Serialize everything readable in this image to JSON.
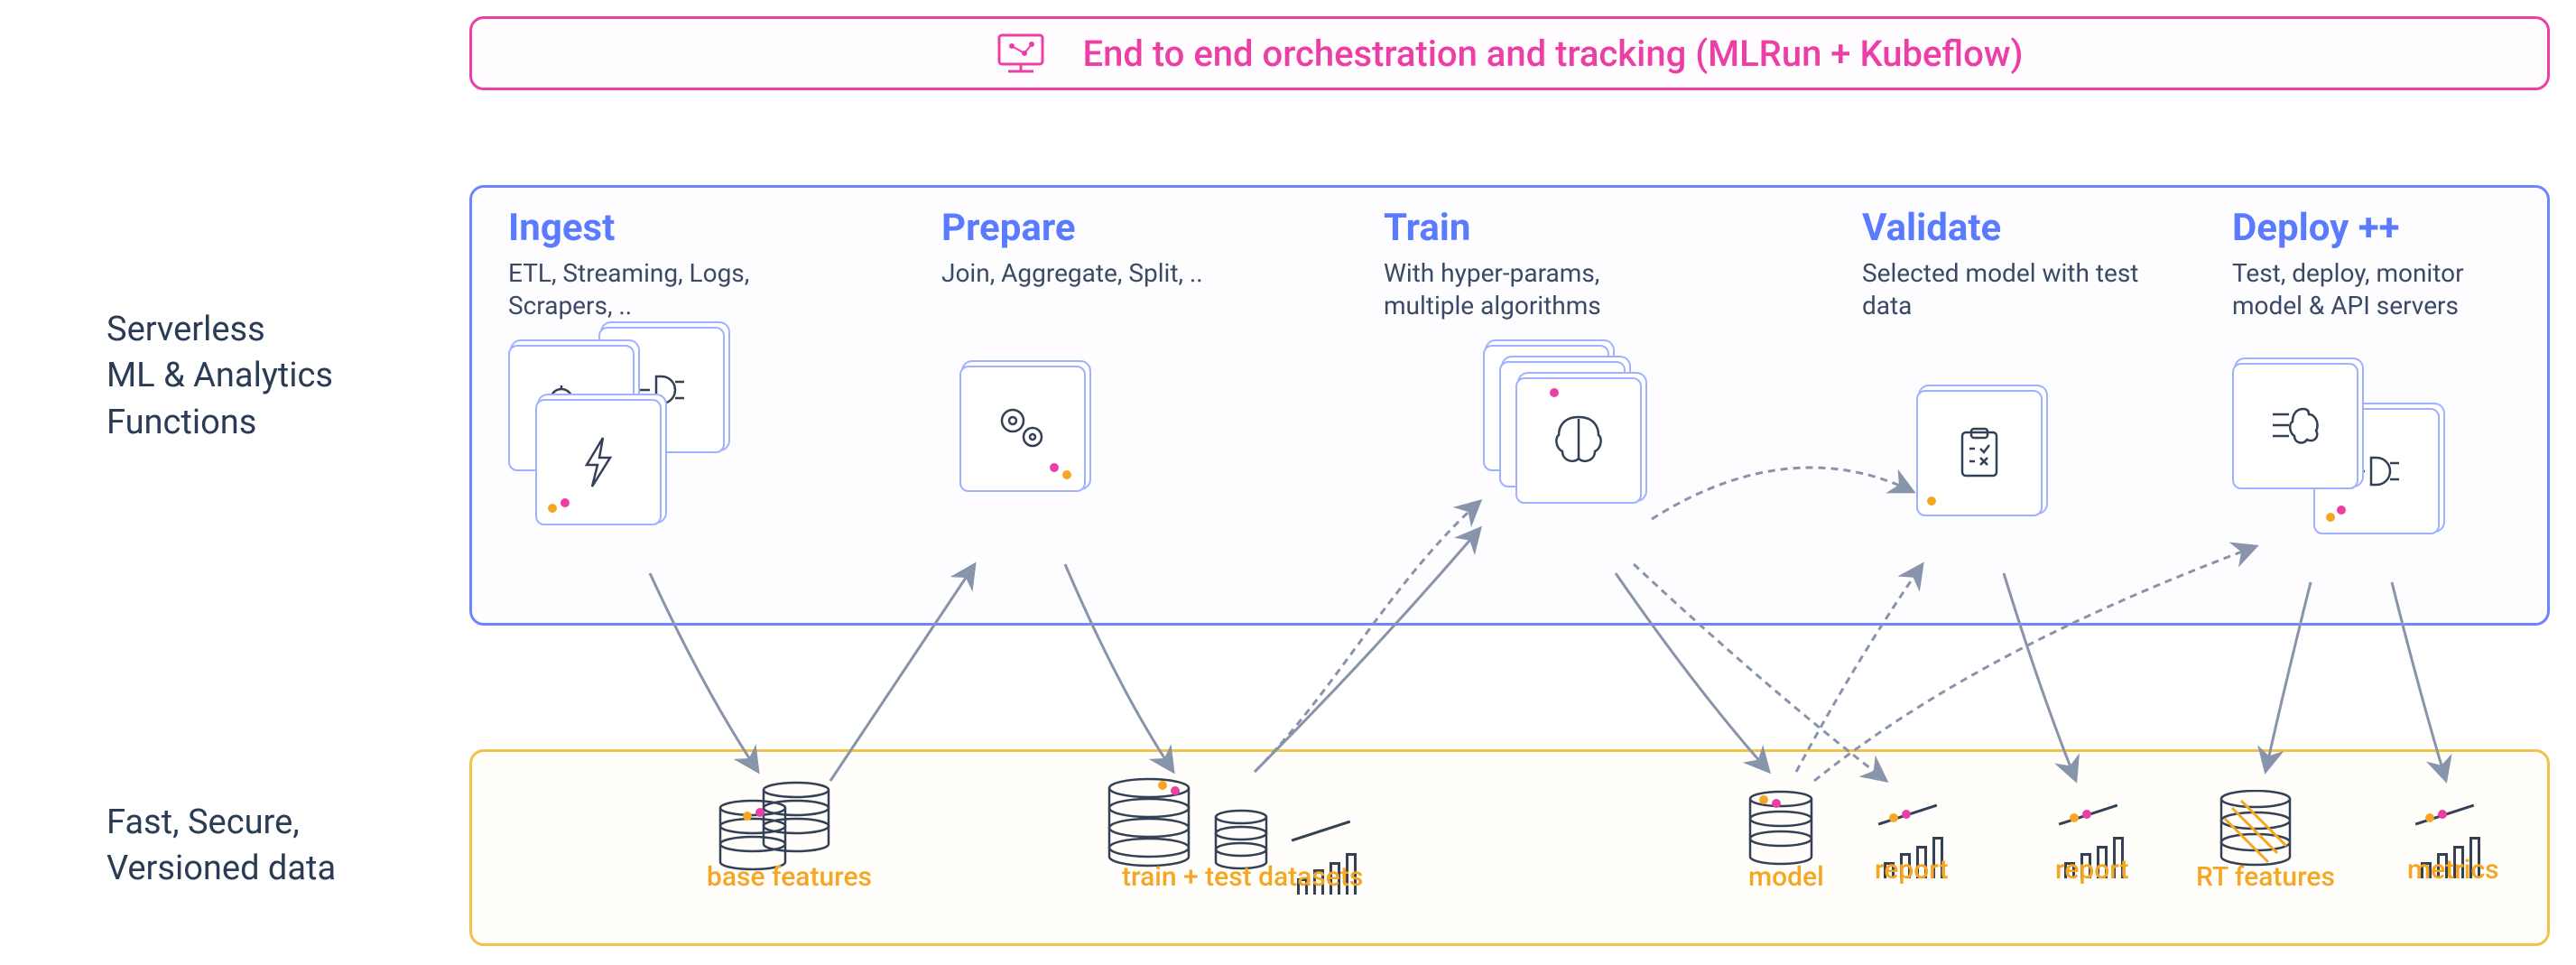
{
  "orchestration": {
    "title": "End to end orchestration and tracking (MLRun + Kubeflow)",
    "icon": "monitor-pipeline-icon"
  },
  "side_labels": {
    "functions": "Serverless\nML & Analytics\nFunctions",
    "data": "Fast, Secure,\nVersioned data"
  },
  "stages": [
    {
      "key": "ingest",
      "title": "Ingest",
      "desc": "ETL, Streaming, Logs, Scrapers, ..",
      "icons": [
        "gears-icon",
        "plug-icon",
        "lightning-icon"
      ]
    },
    {
      "key": "prepare",
      "title": "Prepare",
      "desc": "Join, Aggregate, Split, ..",
      "icons": [
        "gears-icon"
      ]
    },
    {
      "key": "train",
      "title": "Train",
      "desc": "With hyper-params, multiple algorithms",
      "icons": [
        "brain-icon"
      ]
    },
    {
      "key": "validate",
      "title": "Validate",
      "desc": "Selected model with test data",
      "icons": [
        "checklist-icon"
      ]
    },
    {
      "key": "deploy",
      "title": "Deploy ++",
      "desc": "Test, deploy, monitor model & API servers",
      "icons": [
        "brain-lines-icon",
        "plug-icon"
      ]
    }
  ],
  "data_artifacts": [
    {
      "key": "base_features",
      "label": "base features",
      "type": "db-pair"
    },
    {
      "key": "train_test",
      "label": "train + test datasets",
      "type": "db-chart"
    },
    {
      "key": "model",
      "label": "model",
      "type": "db"
    },
    {
      "key": "report1",
      "label": "report",
      "type": "chart"
    },
    {
      "key": "report2",
      "label": "report",
      "type": "chart"
    },
    {
      "key": "rt_features",
      "label": "RT features",
      "type": "db-fast"
    },
    {
      "key": "metrics",
      "label": "metrics",
      "type": "chart"
    }
  ],
  "arrows": [
    {
      "from": "ingest",
      "to": "base_features",
      "style": "solid"
    },
    {
      "from": "base_features",
      "to": "prepare",
      "style": "solid"
    },
    {
      "from": "prepare",
      "to": "train_test",
      "style": "solid"
    },
    {
      "from": "train_test",
      "to": "train",
      "style": "solid"
    },
    {
      "from": "train",
      "to": "model",
      "style": "solid"
    },
    {
      "from": "train",
      "to": "report1",
      "style": "dashed"
    },
    {
      "from": "train",
      "to": "validate",
      "style": "dashed"
    },
    {
      "from": "model",
      "to": "validate",
      "style": "dashed"
    },
    {
      "from": "validate",
      "to": "report2",
      "style": "solid"
    },
    {
      "from": "model",
      "to": "deploy",
      "style": "dashed"
    },
    {
      "from": "deploy",
      "to": "rt_features",
      "style": "solid"
    },
    {
      "from": "deploy",
      "to": "metrics",
      "style": "solid"
    }
  ],
  "colors": {
    "pink": "#ec3ea4",
    "blue": "#5b7bff",
    "blue_border": "#9fb1ff",
    "orange": "#f5a623",
    "text": "#2a3b55",
    "ink": "#344055",
    "arrow": "#8894aa"
  }
}
